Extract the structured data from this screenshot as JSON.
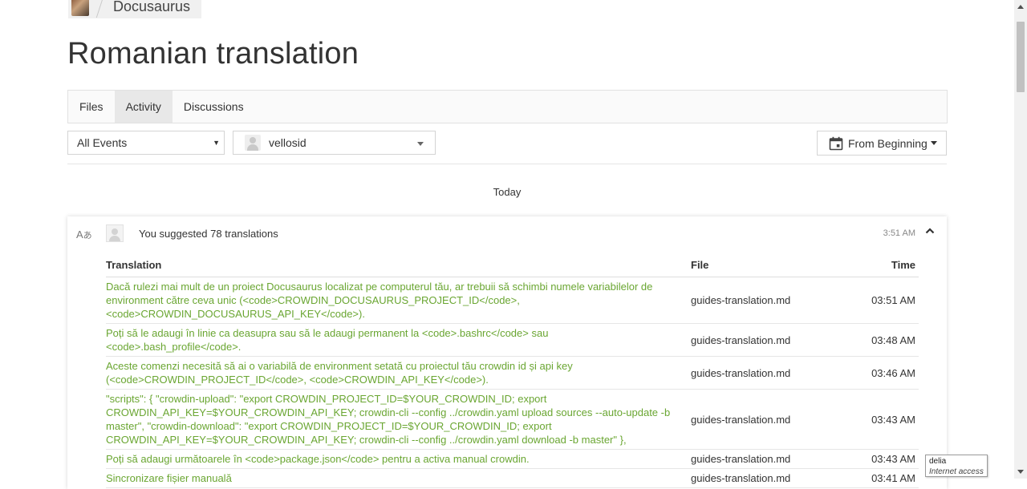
{
  "breadcrumb": {
    "project_name": "Docusaurus"
  },
  "page_title": "Romanian translation",
  "tabs": [
    {
      "label": "Files",
      "active": false
    },
    {
      "label": "Activity",
      "active": true
    },
    {
      "label": "Discussions",
      "active": false
    }
  ],
  "filters": {
    "events": "All Events",
    "user": "vellosid",
    "date_range": "From Beginning"
  },
  "day_label": "Today",
  "event": {
    "summary": "You suggested 78 translations",
    "time": "3:51 AM",
    "columns": {
      "translation": "Translation",
      "file": "File",
      "time": "Time"
    },
    "rows": [
      {
        "text": "Dacă rulezi mai mult de un proiect Docusaurus localizat pe computerul tău, ar trebuii să schimbi numele variabilelor de environment către ceva unic (<code>CROWDIN_DOCUSAURUS_PROJECT_ID</code>, <code>CROWDIN_DOCUSAURUS_API_KEY</code>).",
        "file": "guides-translation.md",
        "time": "03:51 AM"
      },
      {
        "text": "Poți să le adaugi în linie ca deasupra sau să le adaugi permanent la <code>.bashrc</code> sau <code>.bash_profile</code>.",
        "file": "guides-translation.md",
        "time": "03:48 AM"
      },
      {
        "text": "Aceste comenzi necesită să ai o variabilă de environment setată cu proiectul tău crowdin id și api key (<code>CROWDIN_PROJECT_ID</code>, <code>CROWDIN_API_KEY</code>).",
        "file": "guides-translation.md",
        "time": "03:46 AM"
      },
      {
        "text": "\"scripts\": { \"crowdin-upload\": \"export CROWDIN_PROJECT_ID=$YOUR_CROWDIN_ID; export CROWDIN_API_KEY=$YOUR_CROWDIN_API_KEY; crowdin-cli --config ../crowdin.yaml upload sources --auto-update -b master\", \"crowdin-download\": \"export CROWDIN_PROJECT_ID=$YOUR_CROWDIN_ID; export CROWDIN_API_KEY=$YOUR_CROWDIN_API_KEY; crowdin-cli --config ../crowdin.yaml download -b master\" },",
        "file": "guides-translation.md",
        "time": "03:43 AM"
      },
      {
        "text": "Poți să adaugi următoarele în <code>package.json</code> pentru a activa manual crowdin.",
        "file": "guides-translation.md",
        "time": "03:43 AM"
      },
      {
        "text": "Sincronizare fișier manuală",
        "file": "guides-translation.md",
        "time": "03:41 AM"
      }
    ]
  },
  "tooltip": {
    "title": "delia",
    "subtitle": "Internet access"
  },
  "icons": {
    "translate": "translate-icon",
    "calendar": "calendar-icon",
    "collapse": "chevron-up-icon"
  },
  "colors": {
    "suggestion_text": "#6aa632",
    "accent": "#333333"
  }
}
